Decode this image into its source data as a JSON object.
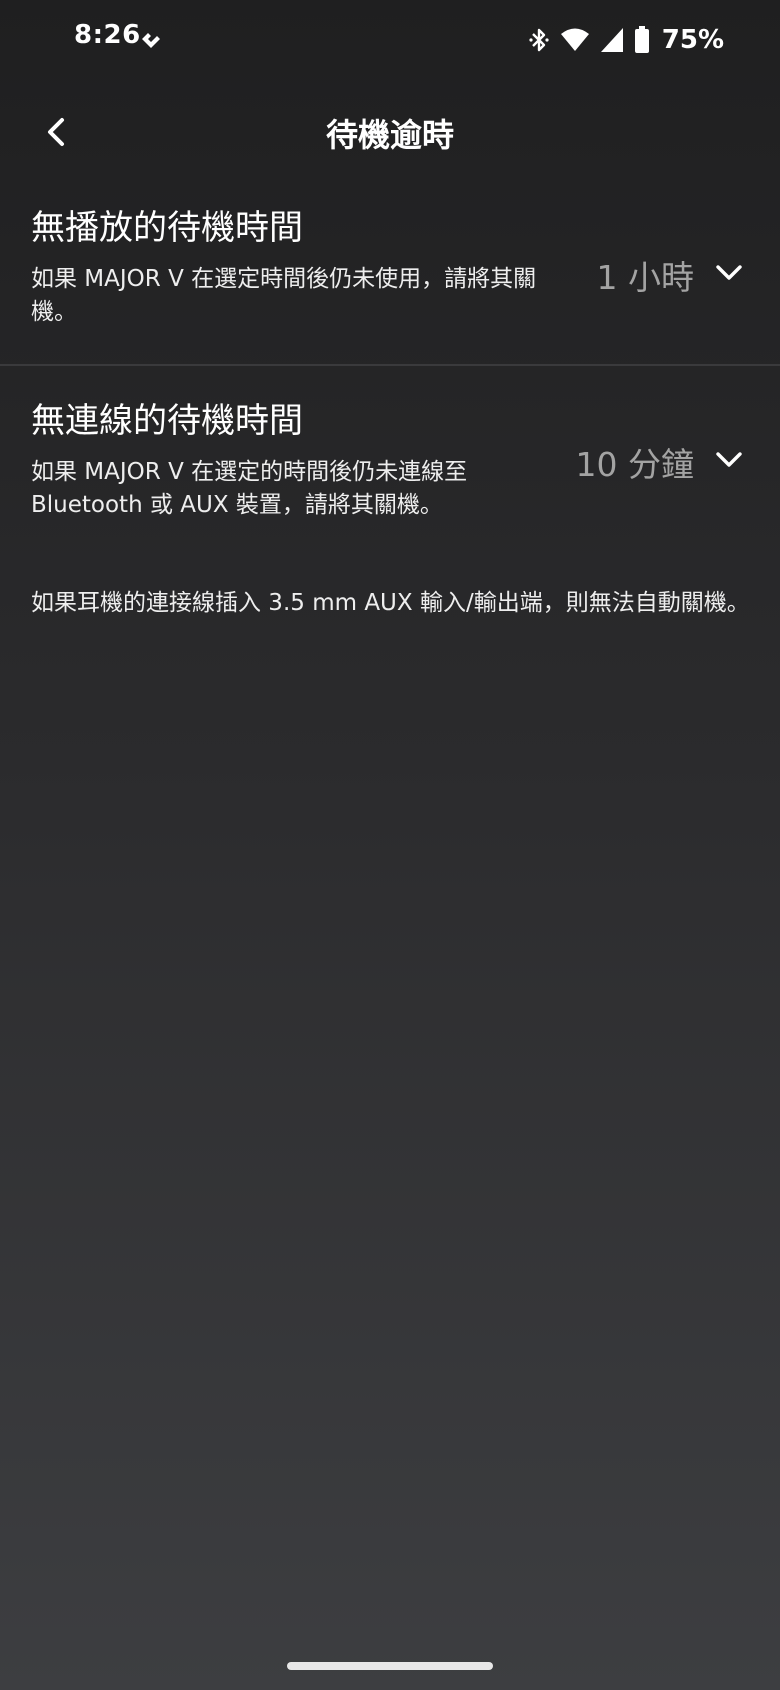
{
  "status_bar": {
    "time": "8:26",
    "battery": "75%",
    "icons": [
      "app-notification-icon",
      "bluetooth-icon",
      "wifi-icon",
      "cell-signal-icon",
      "battery-icon"
    ]
  },
  "header": {
    "title": "待機逾時",
    "back_icon": "chevron-left-icon"
  },
  "settings": [
    {
      "title": "無播放的待機時間",
      "description": "如果 MAJOR V 在選定時間後仍未使用，請將其關機。",
      "value": "1 小時",
      "icon": "chevron-down-icon"
    },
    {
      "title": "無連線的待機時間",
      "description": "如果 MAJOR V 在選定的時間後仍未連線至 Bluetooth 或 AUX 裝置，請將其關機。",
      "value": "10 分鐘",
      "icon": "chevron-down-icon"
    }
  ],
  "footnote": "如果耳機的連接線插入 3.5 mm AUX 輸入/輸出端，則無法自動關機。",
  "colors": {
    "background_top": "#1f1f20",
    "background_bottom": "#3d3e41",
    "text": "#ffffff",
    "value_text": "#a3a3a3"
  }
}
